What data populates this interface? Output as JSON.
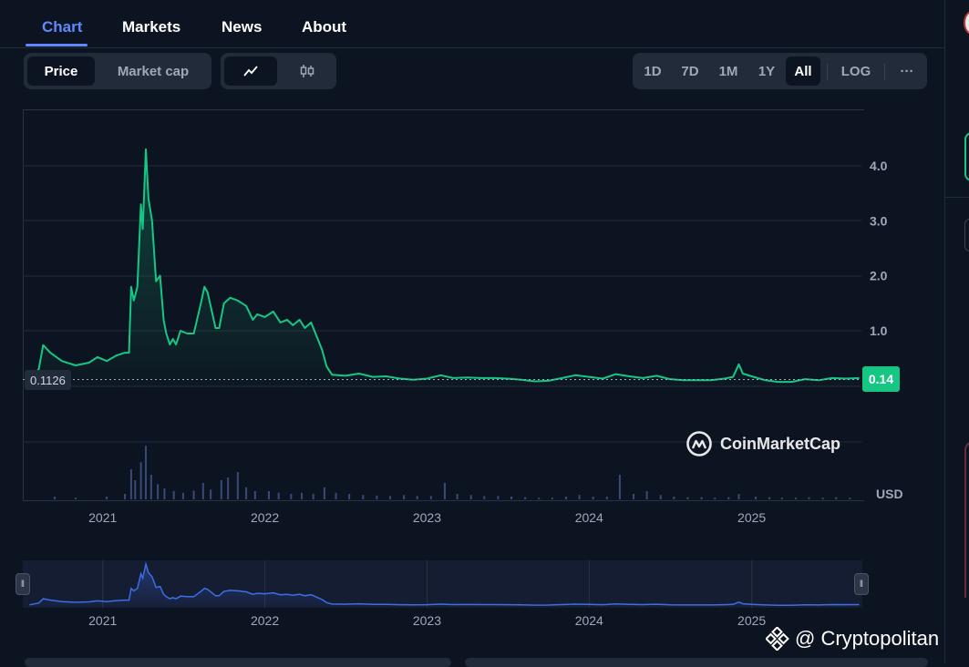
{
  "tabs": [
    {
      "label": "Chart",
      "active": true
    },
    {
      "label": "Markets",
      "active": false
    },
    {
      "label": "News",
      "active": false
    },
    {
      "label": "About",
      "active": false
    }
  ],
  "toggles": {
    "type": [
      {
        "label": "Price",
        "active": true
      },
      {
        "label": "Market cap",
        "active": false
      }
    ],
    "style": [
      {
        "icon": "line-chart-icon",
        "active": true
      },
      {
        "icon": "candlestick-icon",
        "active": false
      }
    ]
  },
  "timeframes": [
    {
      "label": "1D",
      "active": false
    },
    {
      "label": "7D",
      "active": false
    },
    {
      "label": "1M",
      "active": false
    },
    {
      "label": "1Y",
      "active": false
    },
    {
      "label": "All",
      "active": true
    }
  ],
  "scale_button": "LOG",
  "more_button": "···",
  "reference_price": "0.1126",
  "current_price": "0.14",
  "currency": "USD",
  "watermark_logo": "CoinMarketCap",
  "credit": "@ Cryptopolitan",
  "colors": {
    "accent": "#6188ff",
    "line": "#16c784",
    "background": "#0d1421",
    "navigator_line": "#3d6de3"
  },
  "chart_data": {
    "type": "area",
    "title": "",
    "xlabel": "",
    "ylabel": "",
    "x_ticks": [
      "2021",
      "2022",
      "2023",
      "2024",
      "2025"
    ],
    "y_ticks": [
      "1.0",
      "2.0",
      "3.0",
      "4.0"
    ],
    "ylim": [
      -0.2,
      4.8
    ],
    "grid": true,
    "series": [
      {
        "values": [
          [
            "2020-07-20",
            0.11
          ],
          [
            "2020-08-10",
            0.3
          ],
          [
            "2020-08-20",
            0.74
          ],
          [
            "2020-09-05",
            0.6
          ],
          [
            "2020-10-01",
            0.45
          ],
          [
            "2020-11-01",
            0.37
          ],
          [
            "2020-12-01",
            0.42
          ],
          [
            "2020-12-20",
            0.52
          ],
          [
            "2021-01-10",
            0.45
          ],
          [
            "2021-02-01",
            0.55
          ],
          [
            "2021-02-20",
            0.6
          ],
          [
            "2021-03-01",
            0.6
          ],
          [
            "2021-03-06",
            1.8
          ],
          [
            "2021-03-12",
            1.55
          ],
          [
            "2021-03-20",
            1.8
          ],
          [
            "2021-03-28",
            3.3
          ],
          [
            "2021-04-01",
            2.85
          ],
          [
            "2021-04-08",
            4.3
          ],
          [
            "2021-04-14",
            3.4
          ],
          [
            "2021-04-22",
            3.0
          ],
          [
            "2021-05-01",
            1.9
          ],
          [
            "2021-05-10",
            2.0
          ],
          [
            "2021-05-18",
            1.2
          ],
          [
            "2021-05-24",
            0.95
          ],
          [
            "2021-06-01",
            0.75
          ],
          [
            "2021-06-08",
            0.85
          ],
          [
            "2021-06-15",
            0.75
          ],
          [
            "2021-06-25",
            1.0
          ],
          [
            "2021-07-10",
            0.95
          ],
          [
            "2021-07-25",
            0.95
          ],
          [
            "2021-08-10",
            1.5
          ],
          [
            "2021-08-18",
            1.8
          ],
          [
            "2021-08-25",
            1.7
          ],
          [
            "2021-09-05",
            1.3
          ],
          [
            "2021-09-12",
            1.05
          ],
          [
            "2021-09-20",
            1.05
          ],
          [
            "2021-10-01",
            1.5
          ],
          [
            "2021-10-15",
            1.6
          ],
          [
            "2021-11-01",
            1.55
          ],
          [
            "2021-11-20",
            1.45
          ],
          [
            "2021-12-05",
            1.2
          ],
          [
            "2021-12-15",
            1.3
          ],
          [
            "2022-01-01",
            1.25
          ],
          [
            "2022-01-20",
            1.35
          ],
          [
            "2022-02-05",
            1.15
          ],
          [
            "2022-02-20",
            1.2
          ],
          [
            "2022-03-05",
            1.1
          ],
          [
            "2022-03-20",
            1.2
          ],
          [
            "2022-04-01",
            1.05
          ],
          [
            "2022-04-15",
            1.15
          ],
          [
            "2022-04-25",
            0.95
          ],
          [
            "2022-05-10",
            0.65
          ],
          [
            "2022-05-20",
            0.35
          ],
          [
            "2022-06-01",
            0.2
          ],
          [
            "2022-07-01",
            0.18
          ],
          [
            "2022-08-01",
            0.22
          ],
          [
            "2022-09-01",
            0.16
          ],
          [
            "2022-10-01",
            0.17
          ],
          [
            "2022-11-01",
            0.13
          ],
          [
            "2022-12-01",
            0.11
          ],
          [
            "2023-01-01",
            0.13
          ],
          [
            "2023-02-01",
            0.19
          ],
          [
            "2023-03-01",
            0.14
          ],
          [
            "2023-04-01",
            0.15
          ],
          [
            "2023-05-01",
            0.14
          ],
          [
            "2023-06-01",
            0.14
          ],
          [
            "2023-07-01",
            0.13
          ],
          [
            "2023-08-01",
            0.11
          ],
          [
            "2023-09-01",
            0.08
          ],
          [
            "2023-10-01",
            0.09
          ],
          [
            "2023-11-01",
            0.14
          ],
          [
            "2023-12-01",
            0.19
          ],
          [
            "2024-01-01",
            0.16
          ],
          [
            "2024-02-01",
            0.13
          ],
          [
            "2024-03-01",
            0.21
          ],
          [
            "2024-04-01",
            0.17
          ],
          [
            "2024-05-01",
            0.14
          ],
          [
            "2024-06-01",
            0.18
          ],
          [
            "2024-07-01",
            0.12
          ],
          [
            "2024-08-01",
            0.1
          ],
          [
            "2024-09-01",
            0.1
          ],
          [
            "2024-10-01",
            0.1
          ],
          [
            "2024-11-01",
            0.13
          ],
          [
            "2024-11-20",
            0.16
          ],
          [
            "2024-12-03",
            0.39
          ],
          [
            "2024-12-12",
            0.22
          ],
          [
            "2025-01-01",
            0.17
          ],
          [
            "2025-02-01",
            0.1
          ],
          [
            "2025-03-01",
            0.07
          ],
          [
            "2025-04-01",
            0.07
          ],
          [
            "2025-05-01",
            0.12
          ],
          [
            "2025-06-01",
            0.1
          ],
          [
            "2025-07-01",
            0.14
          ],
          [
            "2025-08-01",
            0.13
          ],
          [
            "2025-08-31",
            0.14
          ]
        ]
      }
    ],
    "volume": [
      [
        "2020-09-15",
        0.05
      ],
      [
        "2020-11-01",
        0.03
      ],
      [
        "2021-01-10",
        0.05
      ],
      [
        "2021-02-20",
        0.1
      ],
      [
        "2021-03-06",
        0.55
      ],
      [
        "2021-03-15",
        0.35
      ],
      [
        "2021-03-28",
        0.68
      ],
      [
        "2021-04-08",
        0.98
      ],
      [
        "2021-04-20",
        0.45
      ],
      [
        "2021-05-05",
        0.28
      ],
      [
        "2021-05-20",
        0.2
      ],
      [
        "2021-06-10",
        0.15
      ],
      [
        "2021-07-01",
        0.12
      ],
      [
        "2021-07-25",
        0.16
      ],
      [
        "2021-08-15",
        0.3
      ],
      [
        "2021-09-01",
        0.18
      ],
      [
        "2021-09-25",
        0.35
      ],
      [
        "2021-10-10",
        0.4
      ],
      [
        "2021-11-01",
        0.5
      ],
      [
        "2021-11-20",
        0.22
      ],
      [
        "2021-12-10",
        0.15
      ],
      [
        "2022-01-10",
        0.15
      ],
      [
        "2022-02-01",
        0.12
      ],
      [
        "2022-03-01",
        0.1
      ],
      [
        "2022-03-25",
        0.12
      ],
      [
        "2022-04-20",
        0.1
      ],
      [
        "2022-05-15",
        0.22
      ],
      [
        "2022-06-10",
        0.12
      ],
      [
        "2022-07-10",
        0.1
      ],
      [
        "2022-08-10",
        0.08
      ],
      [
        "2022-09-10",
        0.07
      ],
      [
        "2022-10-10",
        0.06
      ],
      [
        "2022-11-10",
        0.08
      ],
      [
        "2022-12-10",
        0.06
      ],
      [
        "2023-01-10",
        0.06
      ],
      [
        "2023-02-10",
        0.3
      ],
      [
        "2023-03-10",
        0.1
      ],
      [
        "2023-04-10",
        0.08
      ],
      [
        "2023-05-10",
        0.06
      ],
      [
        "2023-06-10",
        0.06
      ],
      [
        "2023-07-10",
        0.05
      ],
      [
        "2023-08-10",
        0.04
      ],
      [
        "2023-09-10",
        0.03
      ],
      [
        "2023-10-10",
        0.03
      ],
      [
        "2023-11-10",
        0.05
      ],
      [
        "2023-12-10",
        0.08
      ],
      [
        "2024-01-10",
        0.05
      ],
      [
        "2024-02-10",
        0.05
      ],
      [
        "2024-03-10",
        0.45
      ],
      [
        "2024-04-10",
        0.1
      ],
      [
        "2024-05-10",
        0.15
      ],
      [
        "2024-06-10",
        0.08
      ],
      [
        "2024-07-10",
        0.05
      ],
      [
        "2024-08-10",
        0.04
      ],
      [
        "2024-09-10",
        0.04
      ],
      [
        "2024-10-10",
        0.03
      ],
      [
        "2024-11-10",
        0.04
      ],
      [
        "2024-12-03",
        0.1
      ],
      [
        "2025-01-10",
        0.05
      ],
      [
        "2025-02-10",
        0.04
      ],
      [
        "2025-03-10",
        0.03
      ],
      [
        "2025-04-10",
        0.03
      ],
      [
        "2025-05-10",
        0.04
      ],
      [
        "2025-06-10",
        0.03
      ],
      [
        "2025-07-10",
        0.04
      ],
      [
        "2025-08-10",
        0.03
      ]
    ]
  }
}
